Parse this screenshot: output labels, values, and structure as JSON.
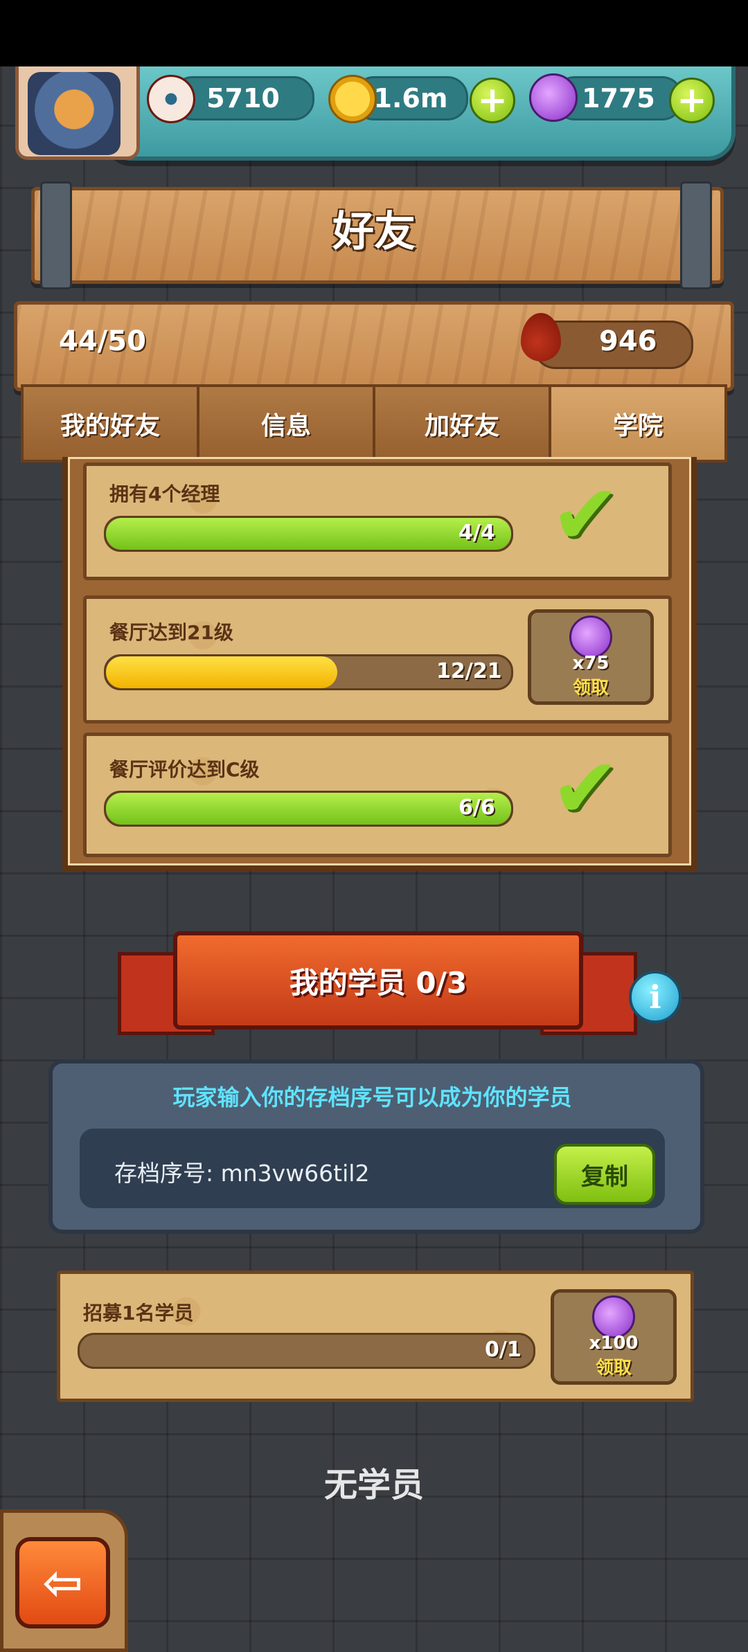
{
  "resources": {
    "eyes": "5710",
    "coins": "1.6m",
    "potions": "1775",
    "plus": "+"
  },
  "header": {
    "title": "好友"
  },
  "friends": {
    "count": "44/50",
    "blood": "946"
  },
  "tabs": [
    {
      "label": "我的好友",
      "active": false
    },
    {
      "label": "信息",
      "active": false
    },
    {
      "label": "加好友",
      "active": false
    },
    {
      "label": "学院",
      "active": true
    }
  ],
  "achievements": [
    {
      "title": "拥有4个经理",
      "progress": "4/4",
      "fill": 1.0,
      "status": "done"
    },
    {
      "title": "餐厅达到21级",
      "progress": "12/21",
      "fill": 0.571,
      "reward_amount": "x75",
      "reward_label": "领取"
    },
    {
      "title": "餐厅评价达到C级",
      "progress": "6/6",
      "fill": 1.0,
      "status": "done"
    }
  ],
  "students": {
    "heading": "我的学员 0/3",
    "info": "i",
    "hint": "玩家输入你的存档序号可以成为你的学员",
    "code_text": "存档序号: mn3vw66til2",
    "copy_label": "复制",
    "recruit": {
      "title": "招募1名学员",
      "progress": "0/1",
      "fill": 0,
      "reward_amount": "x100",
      "reward_label": "领取"
    },
    "empty_text": "无学员"
  },
  "nav": {
    "back": "⇦"
  },
  "colors": {
    "accent_green": "#7fbf10",
    "bar_yellow": "#f2b300",
    "hint_cyan": "#5fe3ff"
  }
}
